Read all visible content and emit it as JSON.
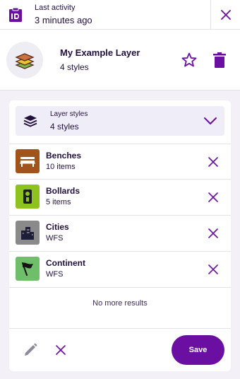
{
  "header": {
    "activity_label": "Last activity",
    "activity_value": "3 minutes ago",
    "icon": "id-clipboard-icon",
    "close_icon": "close-icon"
  },
  "layer": {
    "title": "My Example Layer",
    "subtitle": "4 styles",
    "icon": "layers-icon",
    "favorite_icon": "star-outline-icon",
    "delete_icon": "trash-icon"
  },
  "styles_panel": {
    "label": "Layer styles",
    "count": "4 styles",
    "expanded": true,
    "items": [
      {
        "title": "Benches",
        "subtitle": "10 items",
        "color": "#a0531a",
        "icon": "bench-icon"
      },
      {
        "title": "Bollards",
        "subtitle": "5 items",
        "color": "#8dc21f",
        "icon": "bollard-icon"
      },
      {
        "title": "Cities",
        "subtitle": "WFS",
        "color": "#8a8a8a",
        "icon": "city-buildings-icon"
      },
      {
        "title": "Continent",
        "subtitle": "WFS",
        "color": "#6fbf6a",
        "icon": "flag-icon"
      }
    ],
    "empty_message": "No more results"
  },
  "footer": {
    "save_label": "Save"
  },
  "colors": {
    "accent": "#6b0fa3",
    "text": "#23103d",
    "background": "#f3f0f7"
  }
}
